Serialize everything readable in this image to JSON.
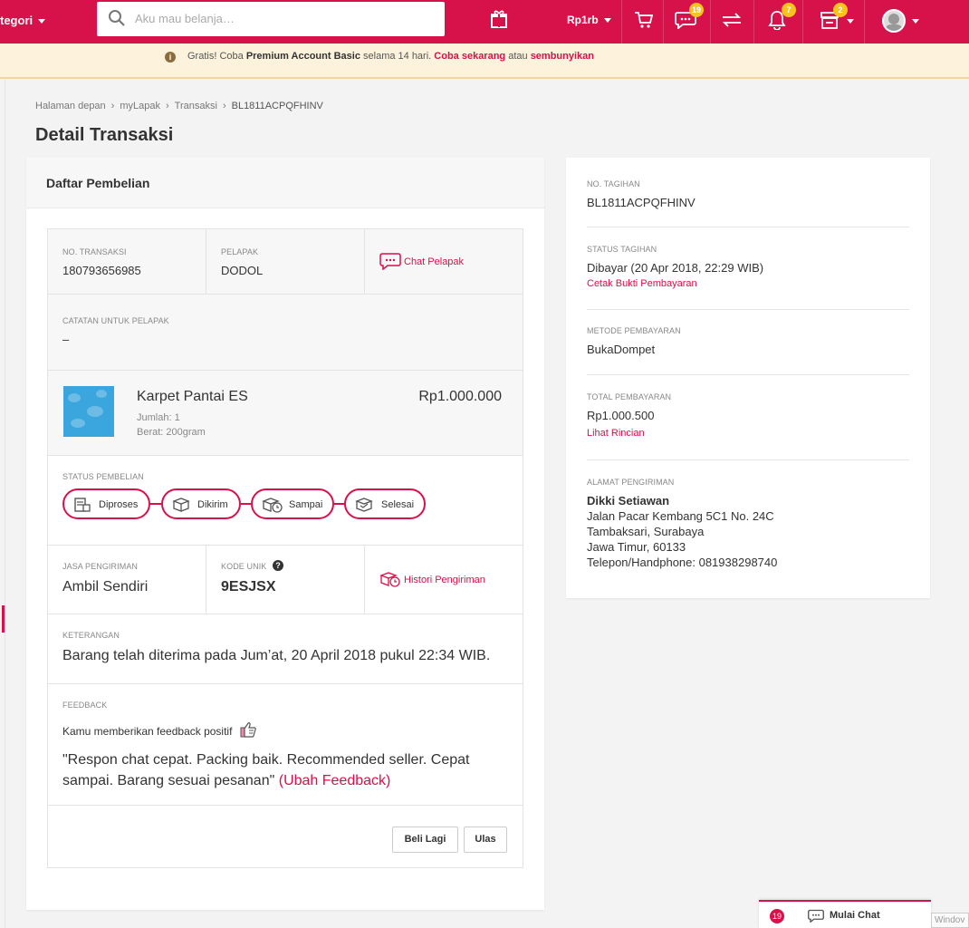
{
  "header": {
    "kategori_label": "tegori",
    "search_placeholder": "Aku mau belanja…",
    "balance": "Rp1rb",
    "chat_badge": "19",
    "notif_badge": "7",
    "store_badge": "2",
    "brand_color": "#d71149"
  },
  "promo": {
    "prefix": "Gratis! Coba ",
    "bold": "Premium Account Basic",
    "middle": " selama 14 hari. ",
    "link1": "Coba sekarang",
    "or": " atau ",
    "link2": "sembunyikan"
  },
  "breadcrumb": [
    "Halaman depan",
    "myLapak",
    "Transaksi",
    "BL1811ACPQFHINV"
  ],
  "page_title": "Detail Transaksi",
  "left": {
    "card_title": "Daftar Pembelian",
    "no_transaksi_label": "NO. TRANSAKSI",
    "no_transaksi": "180793656985",
    "pelapak_label": "PELAPAK",
    "pelapak": "DODOL",
    "chat_pelapak": "Chat Pelapak",
    "catatan_label": "CATATAN UNTUK PELAPAK",
    "catatan": "–",
    "product": {
      "name": "Karpet Pantai ES",
      "qty": "Jumlah: 1",
      "weight": "Berat: 200gram",
      "price": "Rp1.000.000"
    },
    "status_label": "STATUS PEMBELIAN",
    "status_steps": [
      "Diproses",
      "Dikirim",
      "Sampai",
      "Selesai"
    ],
    "jasa_label": "JASA PENGIRIMAN",
    "jasa": "Ambil Sendiri",
    "kode_label": "KODE UNIK",
    "kode": "9ESJSX",
    "histori": "Histori Pengiriman",
    "keterangan_label": "KETERANGAN",
    "keterangan": "Barang telah diterima pada Jum’at, 20 April 2018 pukul 22:34 WIB.",
    "feedback_label": "FEEDBACK",
    "feedback_given": "Kamu memberikan feedback positif",
    "feedback_text_1": "\"Respon chat cepat. Packing baik. Recommended seller. Cepat",
    "feedback_text_2": "sampai. Barang sesuai pesanan\"",
    "ubah_feedback": "(Ubah Feedback)",
    "btn_beli_lagi": "Beli Lagi",
    "btn_ulas": "Ulas"
  },
  "right": {
    "no_tagihan_label": "NO. TAGIHAN",
    "no_tagihan": "BL1811ACPQFHINV",
    "status_tagihan_label": "STATUS TAGIHAN",
    "status_tagihan": "Dibayar (20 Apr 2018, 22:29 WIB)",
    "cetak_bukti": "Cetak Bukti Pembayaran",
    "metode_label": "METODE PEMBAYARAN",
    "metode": "BukaDompet",
    "total_label": "TOTAL PEMBAYARAN",
    "total": "Rp1.000.500",
    "lihat_rincian": "Lihat Rincian",
    "alamat_label": "ALAMAT PENGIRIMAN",
    "nama": "Dikki Setiawan",
    "alamat_1": "Jalan Pacar Kembang 5C1 No. 24C",
    "alamat_2": "Tambaksari, Surabaya",
    "alamat_3": "Jawa Timur, 60133",
    "telepon": "Telepon/Handphone: 081938298740"
  },
  "chatbar": {
    "count": "19",
    "label": "Mulai Chat"
  },
  "os_watermark": "Windov"
}
